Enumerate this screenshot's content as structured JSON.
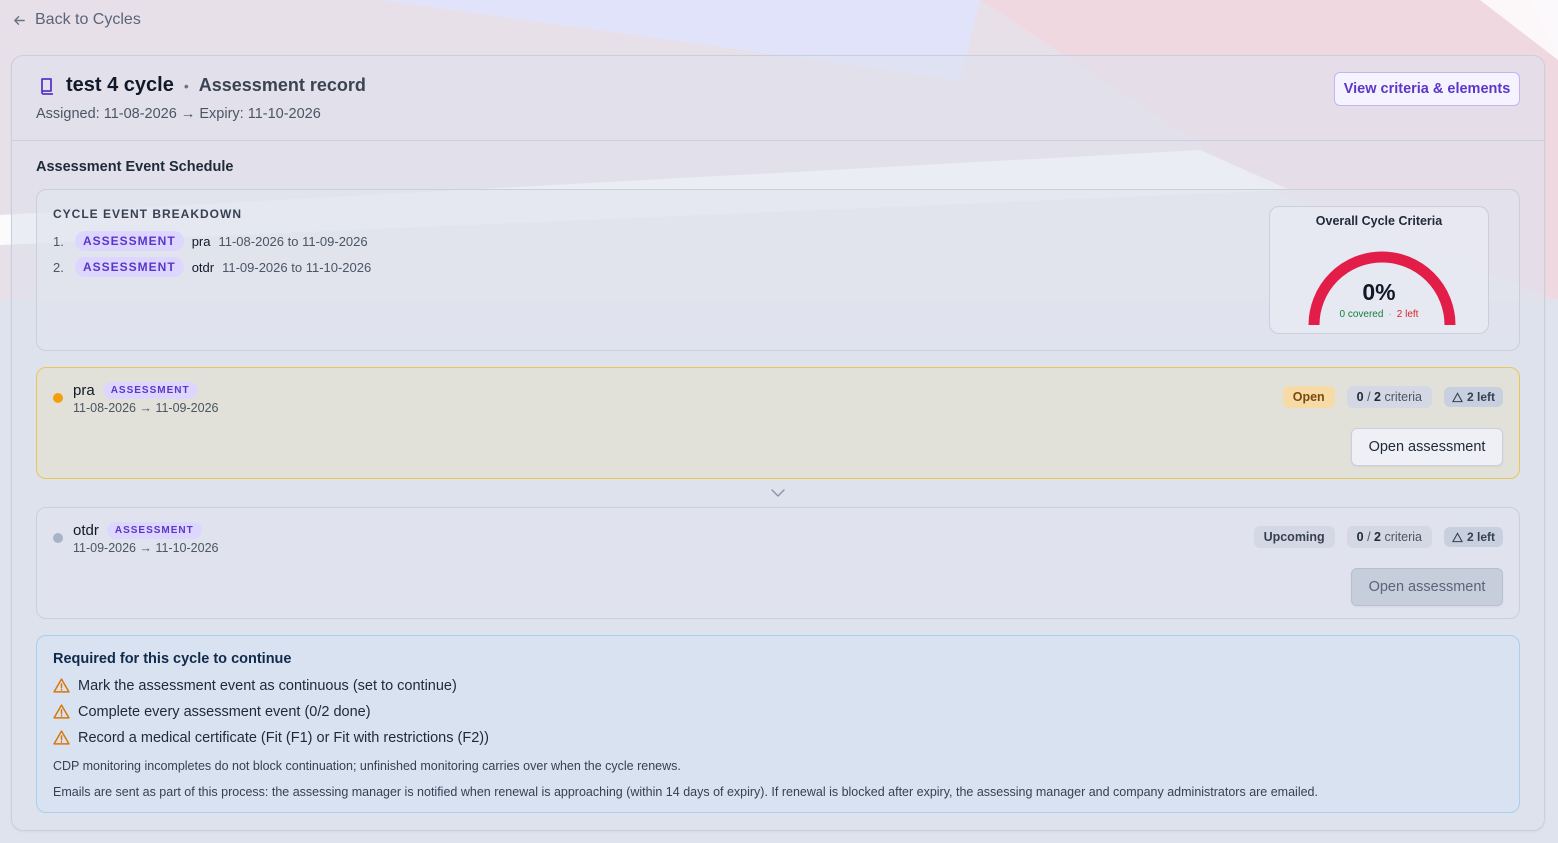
{
  "back": {
    "label": "Back to Cycles"
  },
  "header": {
    "title": "test 4 cycle",
    "subtitle": "Assessment record",
    "assigned": "Assigned: 11-08-2026 → Expiry: 11-10-2026",
    "criteria_button": "View criteria & elements"
  },
  "schedule": {
    "title": "Assessment Event Schedule",
    "breakdown_title": "CYCLE EVENT BREAKDOWN",
    "items": [
      {
        "num": "1.",
        "type": "ASSESSMENT",
        "name": "pra",
        "dates": "11-08-2026 to 11-09-2026"
      },
      {
        "num": "2.",
        "type": "ASSESSMENT",
        "name": "otdr",
        "dates": "11-09-2026 to 11-10-2026"
      }
    ],
    "gauge": {
      "title": "Overall Cycle Criteria",
      "percent": "0%",
      "covered": "0 covered",
      "left": "2 left",
      "color": "#e11d48"
    }
  },
  "events": [
    {
      "name": "pra",
      "type": "ASSESSMENT",
      "dates": "11-08-2026 → 11-09-2026",
      "status": "Open",
      "criteria_done": "0",
      "criteria_sep": " / ",
      "criteria_total": "2",
      "criteria_label": " criteria",
      "left": "2 left",
      "button": "Open assessment",
      "dot_color": "#f59e0b"
    },
    {
      "name": "otdr",
      "type": "ASSESSMENT",
      "dates": "11-09-2026 → 11-10-2026",
      "status": "Upcoming",
      "criteria_done": "0",
      "criteria_sep": " / ",
      "criteria_total": "2",
      "criteria_label": " criteria",
      "left": "2 left",
      "button": "Open assessment",
      "dot_color": "#a8b3c7"
    }
  ],
  "required": {
    "title": "Required for this cycle to continue",
    "items": [
      "Mark the assessment event as continuous (set to continue)",
      "Complete every assessment event (0/2 done)",
      "Record a medical certificate (Fit (F1) or Fit with restrictions (F2))"
    ],
    "note1": "CDP monitoring incompletes do not block continuation; unfinished monitoring carries over when the cycle renews.",
    "note2": "Emails are sent as part of this process: the assessing manager is notified when renewal is approaching (within 14 days of expiry). If renewal is blocked after expiry, the assessing manager and company administrators are emailed."
  }
}
